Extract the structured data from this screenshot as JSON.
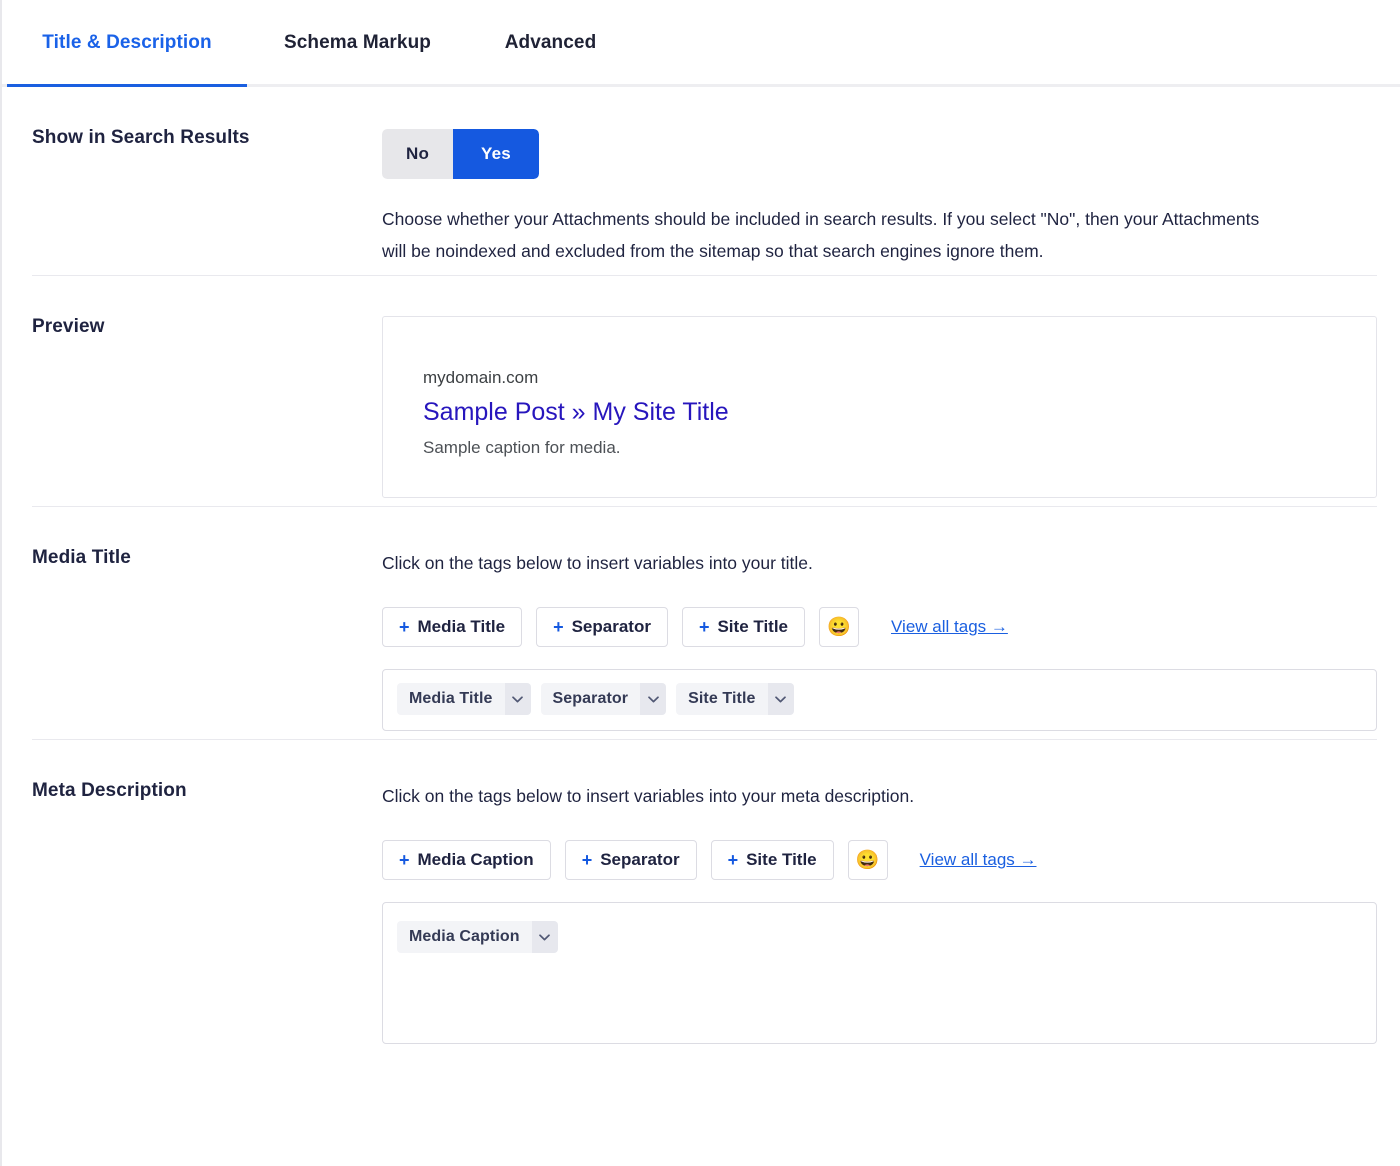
{
  "tabs": [
    {
      "label": "Title & Description",
      "active": true
    },
    {
      "label": "Schema Markup",
      "active": false
    },
    {
      "label": "Advanced",
      "active": false
    }
  ],
  "search_results": {
    "label": "Show in Search Results",
    "option_no": "No",
    "option_yes": "Yes",
    "selected": "Yes",
    "helper": "Choose whether your Attachments should be included in search results. If you select \"No\", then your Attachments will be noindexed and excluded from the sitemap so that search engines ignore them."
  },
  "preview": {
    "label": "Preview",
    "domain": "mydomain.com",
    "title": "Sample Post » My Site Title",
    "description": "Sample caption for media."
  },
  "media_title": {
    "label": "Media Title",
    "helper": "Click on the tags below to insert variables into your title.",
    "insert_buttons": [
      {
        "plus": "+",
        "label": "Media Title"
      },
      {
        "plus": "+",
        "label": "Separator"
      },
      {
        "plus": "+",
        "label": "Site Title"
      }
    ],
    "emoji": "😀",
    "view_all": "View all tags →",
    "tokens": [
      {
        "label": "Media Title"
      },
      {
        "label": "Separator"
      },
      {
        "label": "Site Title"
      }
    ]
  },
  "meta_description": {
    "label": "Meta Description",
    "helper": "Click on the tags below to insert variables into your meta description.",
    "insert_buttons": [
      {
        "plus": "+",
        "label": "Media Caption"
      },
      {
        "plus": "+",
        "label": "Separator"
      },
      {
        "plus": "+",
        "label": "Site Title"
      }
    ],
    "emoji": "😀",
    "view_all": "View all tags →",
    "tokens": [
      {
        "label": "Media Caption"
      }
    ]
  },
  "colors": {
    "accent": "#1559e0",
    "tab_active": "#1a62e8",
    "preview_title": "#2716bd",
    "toggle_off_bg": "#e7e7ea",
    "token_bg": "#f3f4f7",
    "token_caret_bg": "#e7e8ee",
    "text": "#1f2340"
  }
}
